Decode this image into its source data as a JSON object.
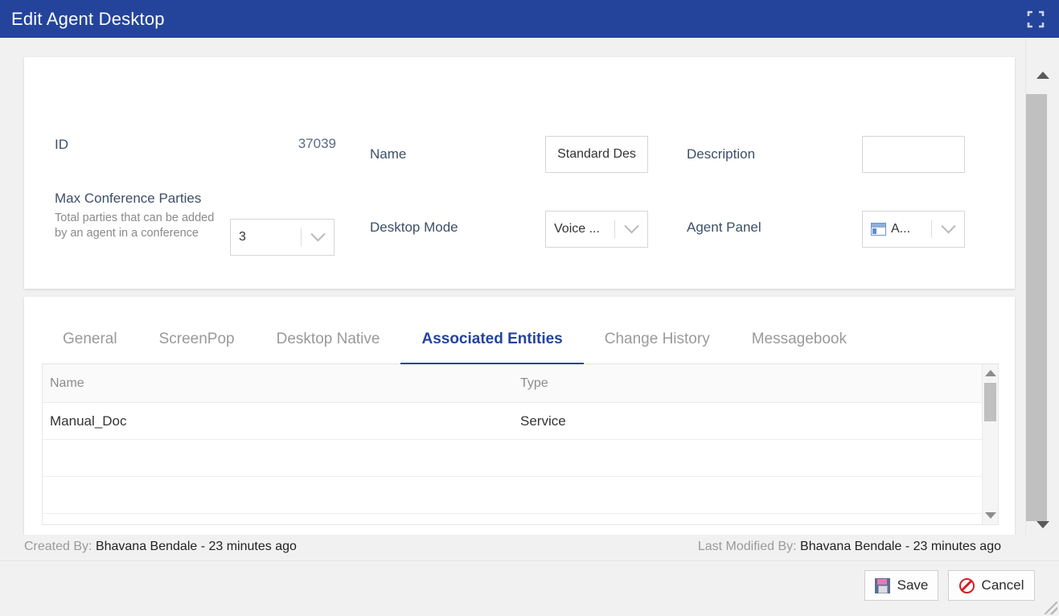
{
  "window": {
    "title": "Edit Agent Desktop",
    "expand_icon": "expand-fullscreen-icon",
    "accent_color": "#24449c"
  },
  "form": {
    "id": {
      "label": "ID",
      "value": "37039"
    },
    "name": {
      "label": "Name",
      "value": "Standard Des",
      "placeholder": ""
    },
    "description": {
      "label": "Description",
      "value": "",
      "placeholder": ""
    },
    "max_conference_parties": {
      "label": "Max Conference Parties",
      "hint": "Total parties that can be added by an agent in a conference",
      "value": "3"
    },
    "desktop_mode": {
      "label": "Desktop Mode",
      "value": "Voice ..."
    },
    "agent_panel": {
      "label": "Agent Panel",
      "value": "A...",
      "icon": "panel-layout-icon"
    }
  },
  "tabs": [
    {
      "label": "General",
      "active": false
    },
    {
      "label": "ScreenPop",
      "active": false
    },
    {
      "label": "Desktop Native",
      "active": false
    },
    {
      "label": "Associated Entities",
      "active": true
    },
    {
      "label": "Change History",
      "active": false
    },
    {
      "label": "Messagebook",
      "active": false
    }
  ],
  "table": {
    "columns": [
      "Name",
      "Type"
    ],
    "rows": [
      {
        "name": "Manual_Doc",
        "type": "Service"
      },
      {
        "name": "",
        "type": ""
      }
    ]
  },
  "meta": {
    "created_by_label": "Created By:",
    "created_by_value": "Bhavana Bendale - 23 minutes ago",
    "last_modified_label": "Last Modified By:",
    "last_modified_value": "Bhavana Bendale - 23 minutes ago"
  },
  "actions": {
    "save": {
      "label": "Save",
      "icon": "floppy-disk-icon"
    },
    "cancel": {
      "label": "Cancel",
      "icon": "prohibition-icon"
    }
  }
}
